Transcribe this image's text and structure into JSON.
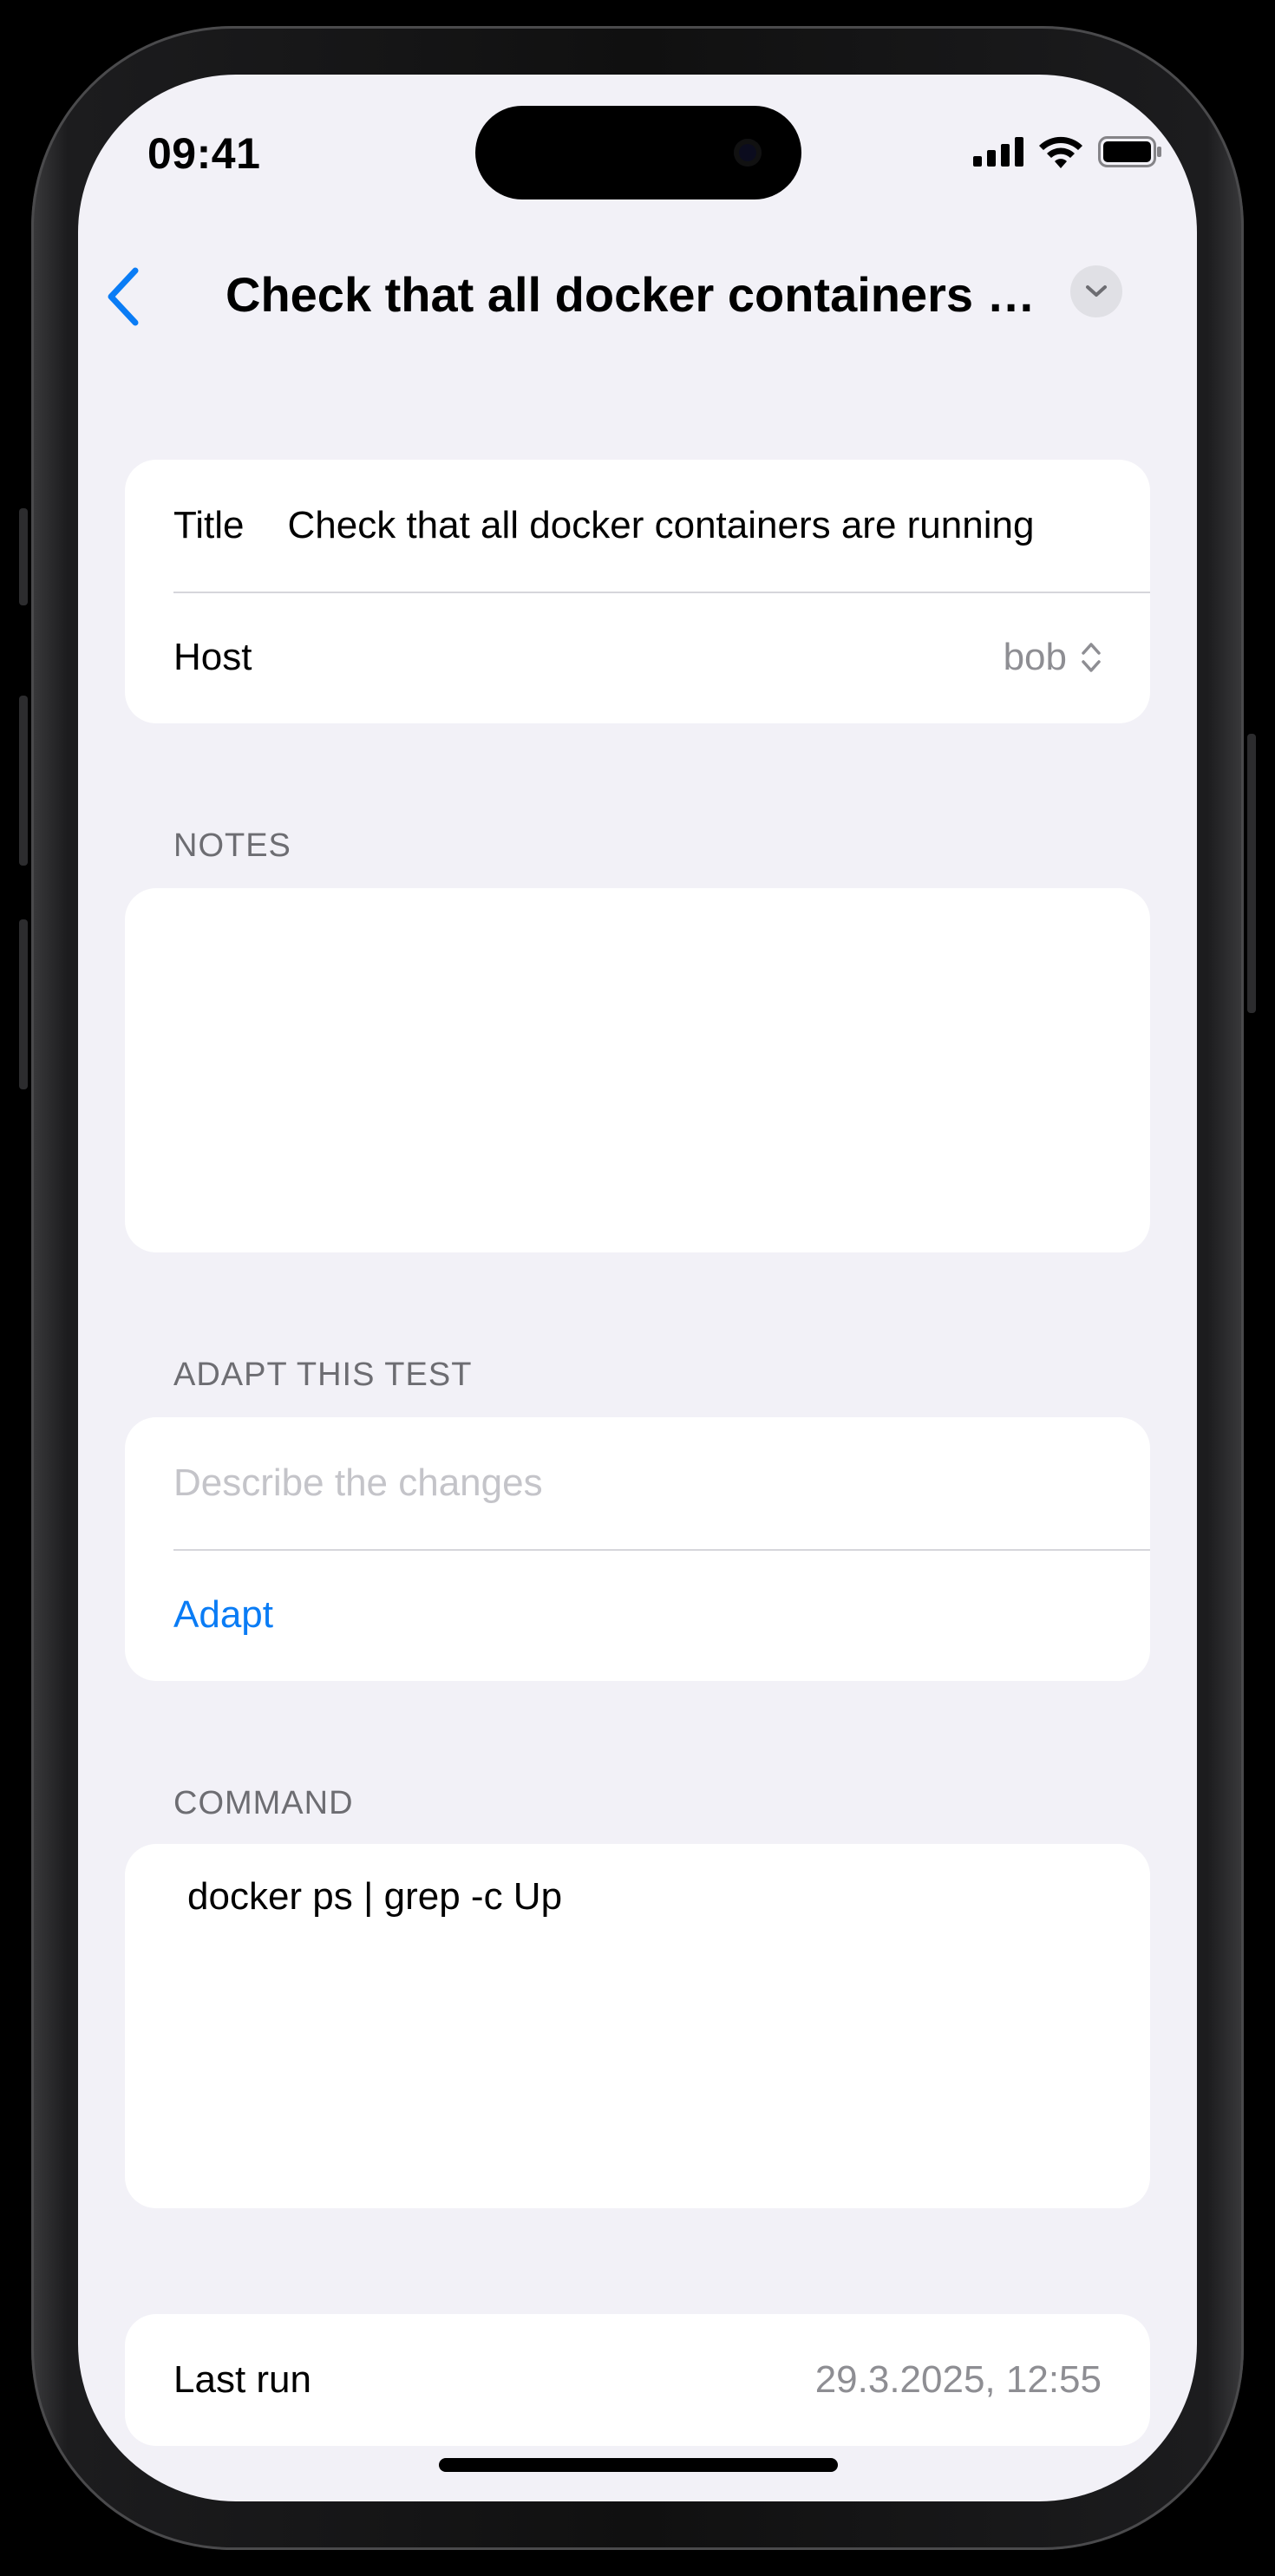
{
  "status_bar": {
    "time": "09:41"
  },
  "nav": {
    "back_icon": "chevron-left-icon",
    "title": "Check that all docker containers are running",
    "menu_icon": "chevron-down-circle-icon"
  },
  "details": {
    "title_label": "Title",
    "title_value": "Check that all docker containers are running",
    "host_label": "Host",
    "host_value": "bob"
  },
  "notes": {
    "header": "NOTES",
    "text": ""
  },
  "adapt": {
    "header": "ADAPT THIS TEST",
    "placeholder": "Describe the changes",
    "button": "Adapt"
  },
  "command": {
    "header": "COMMAND",
    "text": "docker ps | grep -c Up"
  },
  "last_run": {
    "label": "Last run",
    "value": "29.3.2025, 12:55"
  },
  "colors": {
    "accent": "#0a7cf5",
    "background": "#f2f1f7",
    "card": "#ffffff",
    "secondary_text": "#8e8e93"
  }
}
